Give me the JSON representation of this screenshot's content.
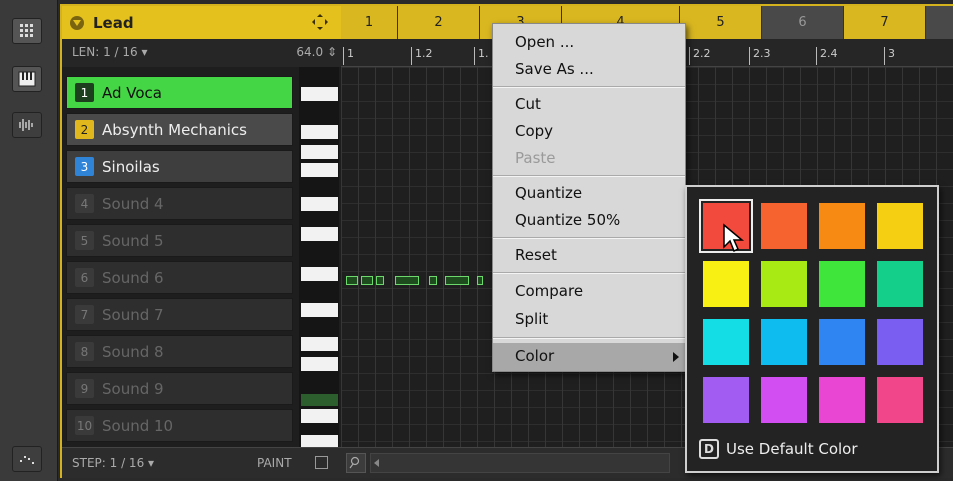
{
  "group": {
    "name": "Lead",
    "color": "#e5c11d"
  },
  "patterns": [
    {
      "label": "1",
      "active": true
    },
    {
      "label": "2",
      "active": true
    },
    {
      "label": "3",
      "active": true
    },
    {
      "label": "4",
      "active": true
    },
    {
      "label": "5",
      "active": true
    },
    {
      "label": "6",
      "active": false
    },
    {
      "label": "7",
      "active": true
    }
  ],
  "pattern_length": "LEN: 1 / 16",
  "tempo": "64.0",
  "ruler_ticks": [
    "1",
    "1.2",
    "1.",
    "2.2",
    "2.3",
    "2.4",
    "3"
  ],
  "sounds": [
    {
      "num": "1",
      "name": "Ad Voca",
      "color": "#45d645"
    },
    {
      "num": "2",
      "name": "Absynth Mechanics",
      "color": "#e0b81e"
    },
    {
      "num": "3",
      "name": "Sinoilas",
      "color": "#2f84d8"
    },
    {
      "num": "4",
      "name": "Sound 4"
    },
    {
      "num": "5",
      "name": "Sound 5"
    },
    {
      "num": "6",
      "name": "Sound 6"
    },
    {
      "num": "7",
      "name": "Sound 7"
    },
    {
      "num": "8",
      "name": "Sound 8"
    },
    {
      "num": "9",
      "name": "Sound 9"
    },
    {
      "num": "10",
      "name": "Sound 10"
    }
  ],
  "bottom_bar": {
    "step": "STEP: 1 / 16",
    "paint_label": "PAINT"
  },
  "context_menu": {
    "open": "Open ...",
    "save_as": "Save As ...",
    "cut": "Cut",
    "copy": "Copy",
    "paste": "Paste",
    "quantize": "Quantize",
    "quantize_50": "Quantize 50%",
    "reset": "Reset",
    "compare": "Compare",
    "split": "Split",
    "color": "Color"
  },
  "color_palette": {
    "swatches": [
      "#f24a3c",
      "#f7632f",
      "#f78a12",
      "#f5cf12",
      "#f7f012",
      "#a7ea14",
      "#3fe53a",
      "#14cf8a",
      "#14dde5",
      "#0ebcf0",
      "#2f86f2",
      "#7a5ef2",
      "#a25cf2",
      "#d24ef2",
      "#ea46d4",
      "#f2468a"
    ],
    "selected_index": 0,
    "default_key": "D",
    "default_label": "Use Default Color"
  }
}
